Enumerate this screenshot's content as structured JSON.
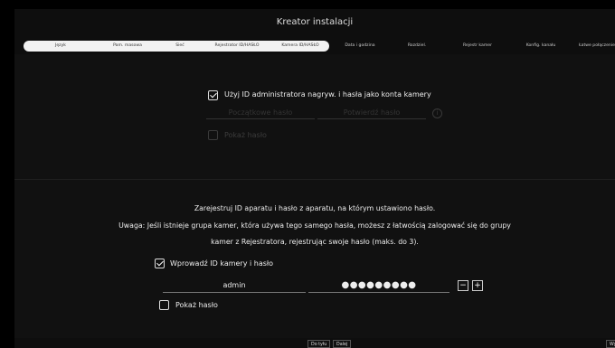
{
  "window": {
    "title": "Kreator instalacji"
  },
  "steps": [
    {
      "label": "Język",
      "state": "done"
    },
    {
      "label": "Pam. masowa",
      "state": "done"
    },
    {
      "label": "Sieć",
      "state": "done"
    },
    {
      "label": "Rejestrator ID/HASŁO",
      "state": "done"
    },
    {
      "label": "Kamera ID/HASŁO",
      "state": "current"
    },
    {
      "label": "Data i godzina",
      "state": "pending"
    },
    {
      "label": "Rozdziel.",
      "state": "pending"
    },
    {
      "label": "Rejestr kamer",
      "state": "pending"
    },
    {
      "label": "Konfig. kanału",
      "state": "pending"
    },
    {
      "label": "Łatwe połączenie",
      "state": "pending"
    }
  ],
  "section1": {
    "use_admin_label": "Użyj ID administratora nagryw. i hasła jako konta kamery",
    "initial_password_placeholder": "Początkowe hasło",
    "confirm_password_placeholder": "Potwierdź hasło",
    "info_icon": "info-circle-icon",
    "show_password_label": "Pokaż hasło"
  },
  "section2": {
    "line1": "Zarejestruj ID aparatu i hasło z aparatu, na którym ustawiono hasło.",
    "line2": "Uwaga: Jeśli istnieje grupa kamer, która używa tego samego hasła, możesz z łatwością zalogować się do grupy",
    "line3": "kamer z Rejestratora, rejestrując swoje hasło (maks. do 3).",
    "enter_id_label": "Wprowadź ID kamery i hasło",
    "id_value": "admin",
    "password_value": "●●●●●●●●●",
    "minus_label": "−",
    "plus_label": "+",
    "show_password_label": "Pokaż hasło"
  },
  "footer": {
    "back_label": "Do tyłu",
    "next_label": "Dalej",
    "exit_label": "Wy"
  }
}
